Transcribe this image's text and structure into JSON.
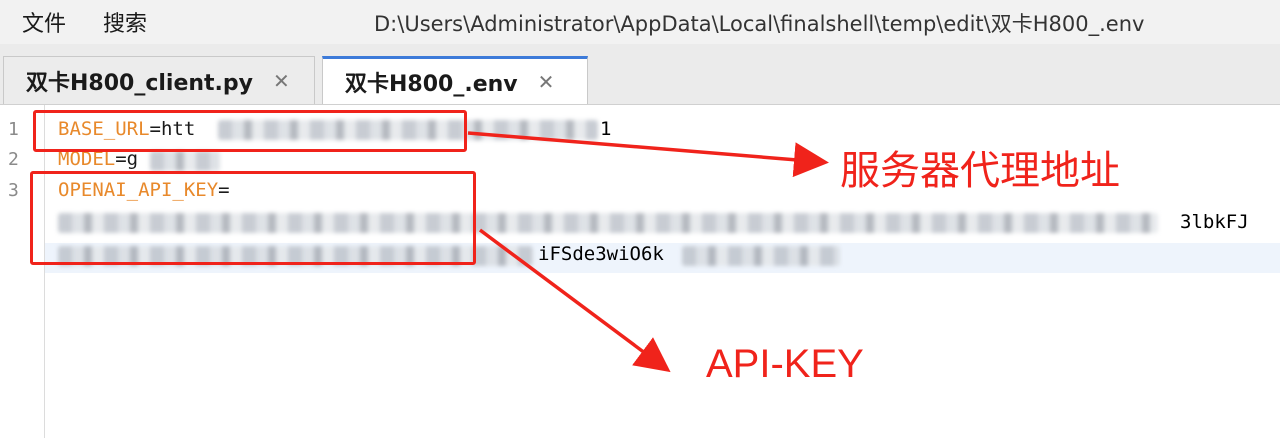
{
  "menu": {
    "file": "文件",
    "search": "搜索"
  },
  "path": "D:\\Users\\Administrator\\AppData\\Local\\finalshell\\temp\\edit\\双卡H800_.env",
  "tabs": [
    {
      "label": "双卡H800_client.py",
      "close": "✕"
    },
    {
      "label": "双卡H800_.env",
      "close": "✕"
    }
  ],
  "lines": {
    "l1": {
      "num": "1",
      "key": "BASE_URL",
      "eq": "=",
      "value_start": "htt",
      "value_end": "1"
    },
    "l2": {
      "num": "2",
      "key": "MODEL",
      "eq": "=",
      "value_start": "g"
    },
    "l3": {
      "num": "3",
      "key": "OPENAI_API_KEY",
      "eq": "="
    },
    "l4": {
      "value_end": "3lbkFJ"
    },
    "l5": {
      "value_mid": "iFSde3wiO6k"
    }
  },
  "annotations": {
    "proxy": "服务器代理地址",
    "apikey": "API-KEY",
    "color": "#f0231b"
  }
}
